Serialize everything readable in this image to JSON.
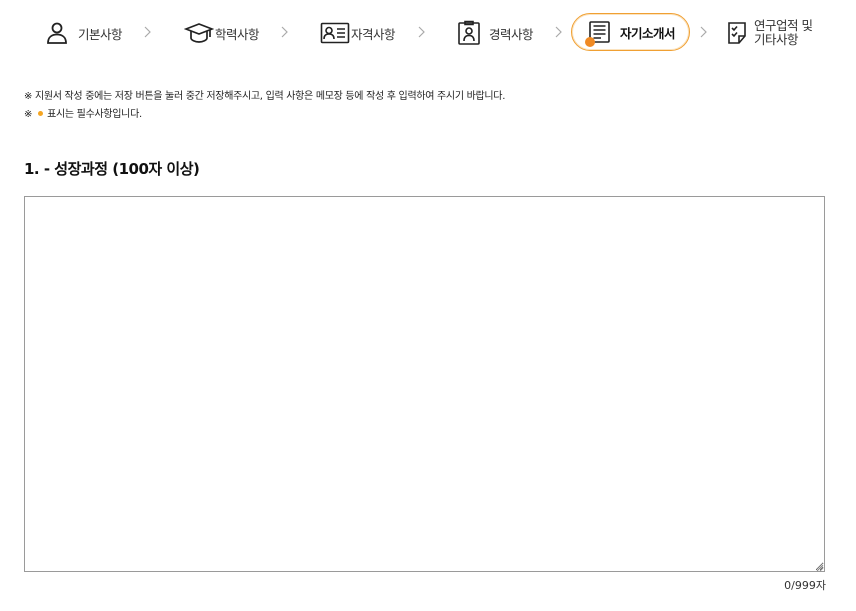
{
  "steps": [
    {
      "label": "기본사항",
      "icon": "person-icon",
      "active": false
    },
    {
      "label": "학력사항",
      "icon": "graduation-cap-icon",
      "active": false
    },
    {
      "label": "자격사항",
      "icon": "id-card-icon",
      "active": false
    },
    {
      "label": "경력사항",
      "icon": "worker-badge-icon",
      "active": false
    },
    {
      "label": "자기소개서",
      "icon": "newspaper-icon",
      "active": true
    },
    {
      "label_line1": "연구업적 및",
      "label_line2": "기타사항",
      "icon": "checklist-document-icon",
      "active": false
    }
  ],
  "notices": {
    "line1": "※ 지원서 작성 중에는 저장 버튼을 눌러 중간 저장해주시고, 입력 사항은 메모장 등에 작성 후 입력하여 주시기 바랍니다.",
    "line2_prefix": "※",
    "line2_text": "표시는 필수사항입니다."
  },
  "question": {
    "title": "1. - 성장과정 (100자 이상)",
    "value": "",
    "counter": "0/999자"
  },
  "colors": {
    "accent": "#f0a033",
    "required_dot": "#f5a623",
    "active_dot": "#f08a24"
  }
}
